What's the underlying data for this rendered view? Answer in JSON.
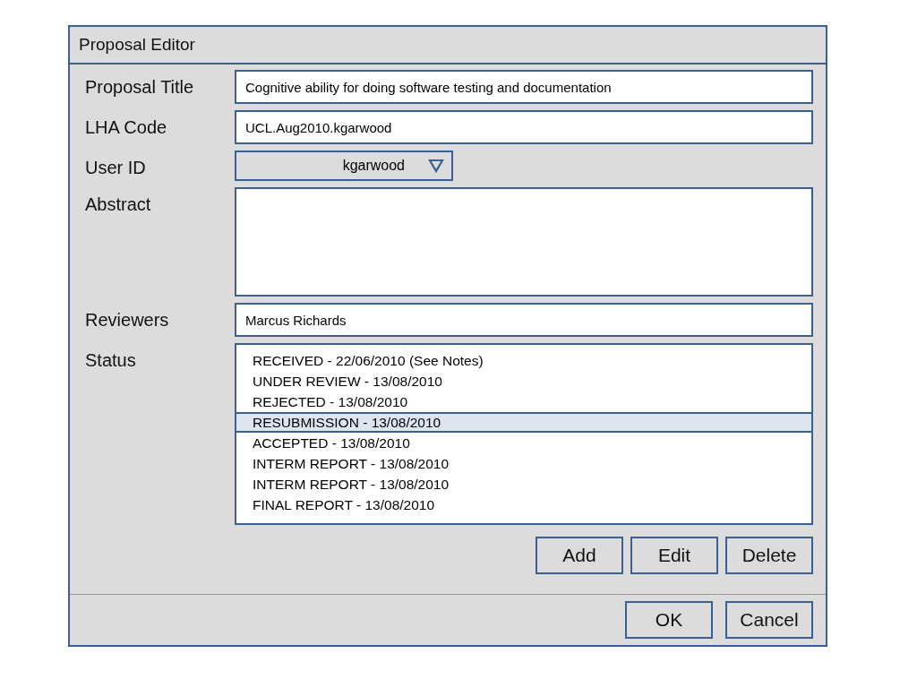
{
  "window": {
    "title": "Proposal Editor"
  },
  "fields": [
    {
      "label": "Proposal Title",
      "kind": "text",
      "value": "Cognitive ability for doing software testing and documentation"
    },
    {
      "label": "LHA Code",
      "kind": "text",
      "value": "UCL.Aug2010.kgarwood"
    },
    {
      "label": "User ID",
      "kind": "select",
      "value": "kgarwood"
    },
    {
      "label": "Abstract",
      "kind": "textarea"
    },
    {
      "label": "Reviewers",
      "kind": "text",
      "value": "Marcus Richards"
    }
  ],
  "status": {
    "label": "Status",
    "items": [
      {
        "text": "RECEIVED  - 22/06/2010 (See Notes)",
        "selected": false
      },
      {
        "text": "UNDER REVIEW - 13/08/2010",
        "selected": false
      },
      {
        "text": "REJECTED - 13/08/2010",
        "selected": false
      },
      {
        "text": "RESUBMISSION - 13/08/2010",
        "selected": true
      },
      {
        "text": "ACCEPTED - 13/08/2010",
        "selected": false
      },
      {
        "text": "INTERM REPORT - 13/08/2010",
        "selected": false
      },
      {
        "text": "INTERM REPORT - 13/08/2010",
        "selected": false
      },
      {
        "text": "FINAL REPORT - 13/08/2010",
        "selected": false
      }
    ]
  },
  "list_buttons": [
    "Add",
    "Edit",
    "Delete"
  ],
  "dialog_buttons": [
    "OK",
    "Cancel"
  ]
}
